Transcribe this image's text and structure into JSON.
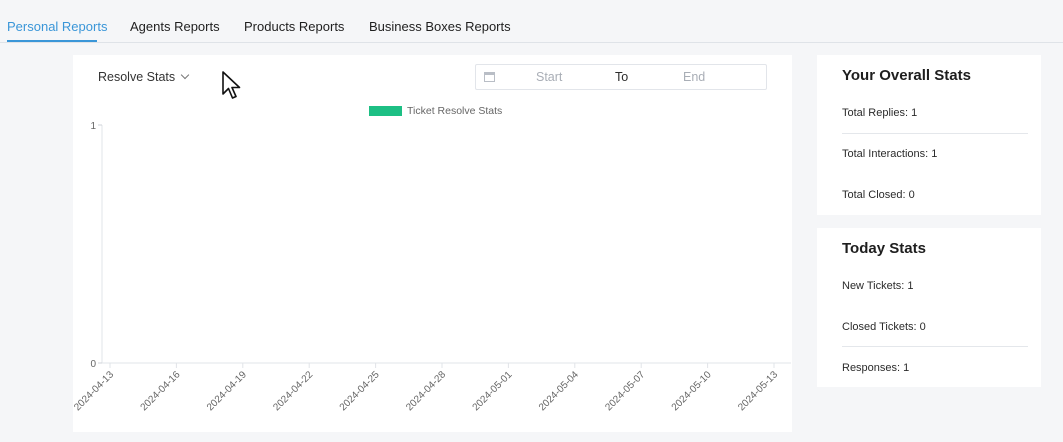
{
  "tabs": [
    {
      "label": "Personal Reports",
      "active": true
    },
    {
      "label": "Agents Reports",
      "active": false
    },
    {
      "label": "Products Reports",
      "active": false
    },
    {
      "label": "Business Boxes Reports",
      "active": false
    }
  ],
  "chart_controls": {
    "dropdown_label": "Resolve Stats",
    "date_start_placeholder": "Start",
    "date_separator": "To",
    "date_end_placeholder": "End"
  },
  "chart_data": {
    "type": "bar",
    "legend": [
      {
        "name": "Ticket Resolve Stats",
        "color": "#1dbf84"
      }
    ],
    "legend_position": "top-center",
    "x": [
      "2024-04-13",
      "2024-04-16",
      "2024-04-19",
      "2024-04-22",
      "2024-04-25",
      "2024-04-28",
      "2024-05-01",
      "2024-05-04",
      "2024-05-07",
      "2024-05-10",
      "2024-05-13"
    ],
    "series": [
      {
        "name": "Ticket Resolve Stats",
        "values": []
      }
    ],
    "y_ticks": [
      "0",
      "1"
    ],
    "ylim": [
      0,
      1
    ],
    "grid": false
  },
  "overall_stats": {
    "title": "Your Overall Stats",
    "rows": [
      {
        "label": "Total Replies:",
        "value": "1"
      },
      {
        "label": "Total Interactions:",
        "value": "1"
      },
      {
        "label": "Total Closed:",
        "value": "0"
      }
    ]
  },
  "today_stats": {
    "title": "Today Stats",
    "rows": [
      {
        "label": "New Tickets:",
        "value": "1"
      },
      {
        "label": "Closed Tickets:",
        "value": "0"
      },
      {
        "label": "Responses:",
        "value": "1"
      }
    ]
  },
  "icons": {
    "calendar": "calendar-icon",
    "dropdown": "chevron-down-icon",
    "pointer": "mouse-cursor-icon"
  }
}
